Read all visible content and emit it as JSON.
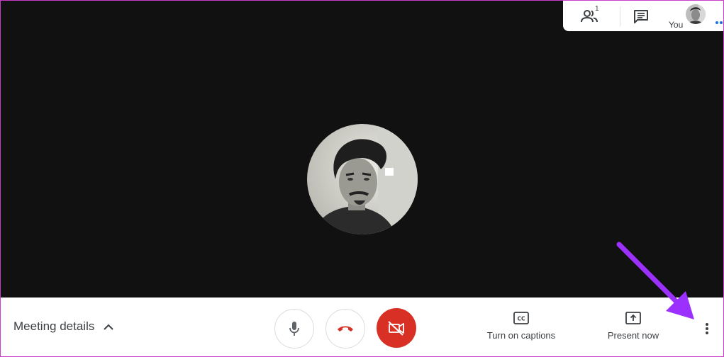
{
  "top_panel": {
    "participants_count": "1",
    "you_label": "You"
  },
  "bottom_bar": {
    "meeting_details_label": "Meeting details",
    "captions_label": "Turn on captions",
    "present_label": "Present now"
  },
  "colors": {
    "stage_background": "#111111",
    "hangup_red": "#d93025",
    "annotation_arrow": "#9b30ff",
    "accent_blue": "#1a73e8"
  },
  "icons": {
    "participants": "people-icon",
    "chat": "chat-icon",
    "microphone": "microphone-icon",
    "hangup": "phone-hangup-icon",
    "camera_off": "camera-off-icon",
    "captions": "captions-icon",
    "present": "present-screen-icon",
    "more": "more-vertical-icon",
    "chevron": "chevron-up-icon"
  }
}
